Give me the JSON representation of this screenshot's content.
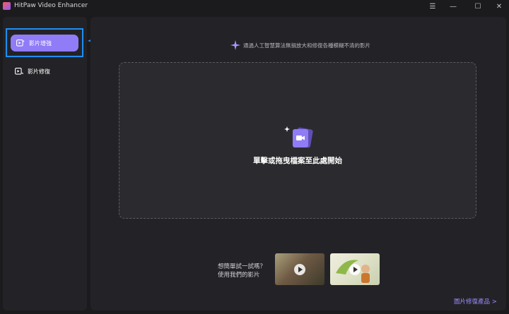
{
  "window": {
    "title": "HitPaw Video Enhancer",
    "controls": {
      "menu": "☰",
      "minimize": "—",
      "maximize": "☐",
      "close": "✕"
    }
  },
  "sidebar": {
    "items": [
      {
        "label": "影片增強",
        "icon": "video-enhance-icon",
        "active": true
      },
      {
        "label": "影片修復",
        "icon": "video-repair-icon",
        "active": false
      }
    ]
  },
  "main": {
    "hint": "通過人工智慧算法無損放大和修復各種模糊不清的影片",
    "dropzone_label": "單擊或拖曳檔案至此處開始",
    "try_line1": "想簡單試一試嗎？",
    "try_line2": "使用我們的影片",
    "more_link": "圖片修復產品 >"
  },
  "colors": {
    "accent": "#8f7cf6",
    "highlight": "#1e8ff2",
    "link": "#9d8cff"
  }
}
